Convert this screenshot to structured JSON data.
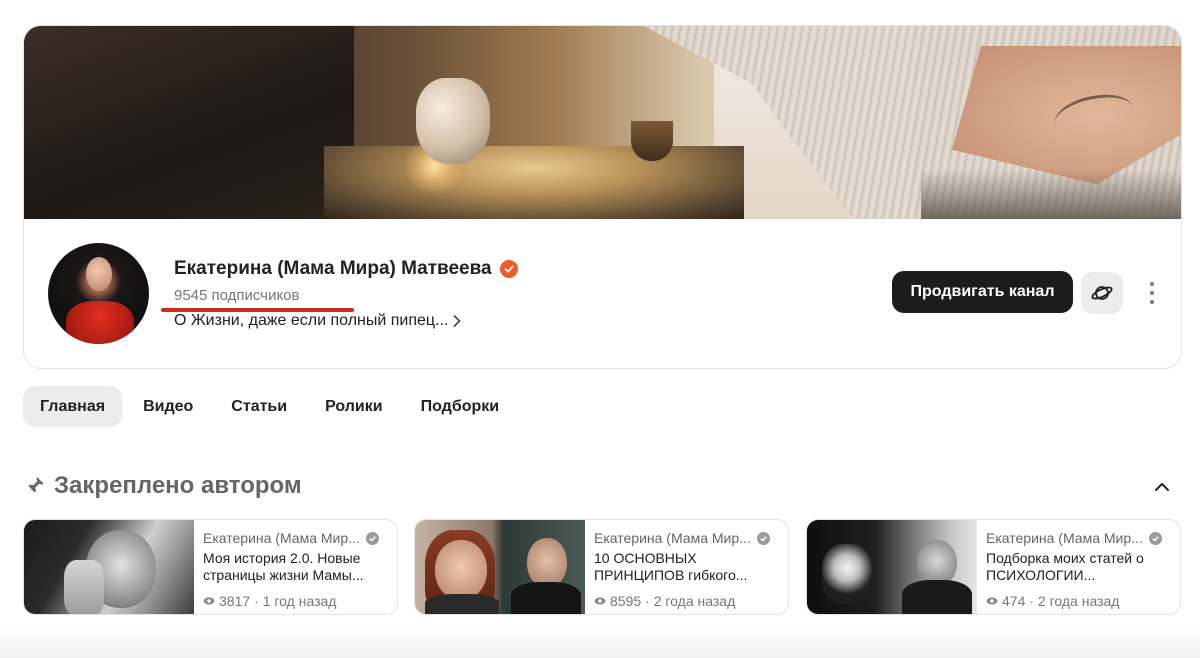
{
  "channel": {
    "name": "Екатерина (Мама Мира) Матвеева",
    "subscribers": "9545 подписчиков",
    "description": "О Жизни, даже если полный пипец...",
    "verified": true,
    "verified_color": "#f05a23"
  },
  "actions": {
    "promote_label": "Продвигать канал",
    "planet_icon": "planet-icon",
    "more_icon": "more-vertical-icon"
  },
  "tabs": [
    {
      "label": "Главная",
      "active": true
    },
    {
      "label": "Видео",
      "active": false
    },
    {
      "label": "Статьи",
      "active": false
    },
    {
      "label": "Ролики",
      "active": false
    },
    {
      "label": "Подборки",
      "active": false
    }
  ],
  "pinned": {
    "title": "Закреплено автором",
    "icon": "pin-icon",
    "collapse_icon": "chevron-up-icon"
  },
  "cards": [
    {
      "author": "Екатерина (Мама Мир...",
      "title_line1": "Моя история 2.0. Новые",
      "title_line2": "страницы жизни Мамы...",
      "views": "3817",
      "age": "· 1 год назад"
    },
    {
      "author": "Екатерина (Мама Мир...",
      "title_line1": "10 ОСНОВНЫХ",
      "title_line2": "ПРИНЦИПОВ гибкого...",
      "views": "8595",
      "age": "· 2 года назад"
    },
    {
      "author": "Екатерина (Мама Мир...",
      "title_line1": "Подборка моих статей о",
      "title_line2": "ПСИХОЛОГИИ...",
      "views": "474",
      "age": "· 2 года назад"
    }
  ],
  "colors": {
    "accent_underline": "#d32a1f",
    "button_dark": "#1c1c1c",
    "tab_active_bg": "#ececec"
  }
}
